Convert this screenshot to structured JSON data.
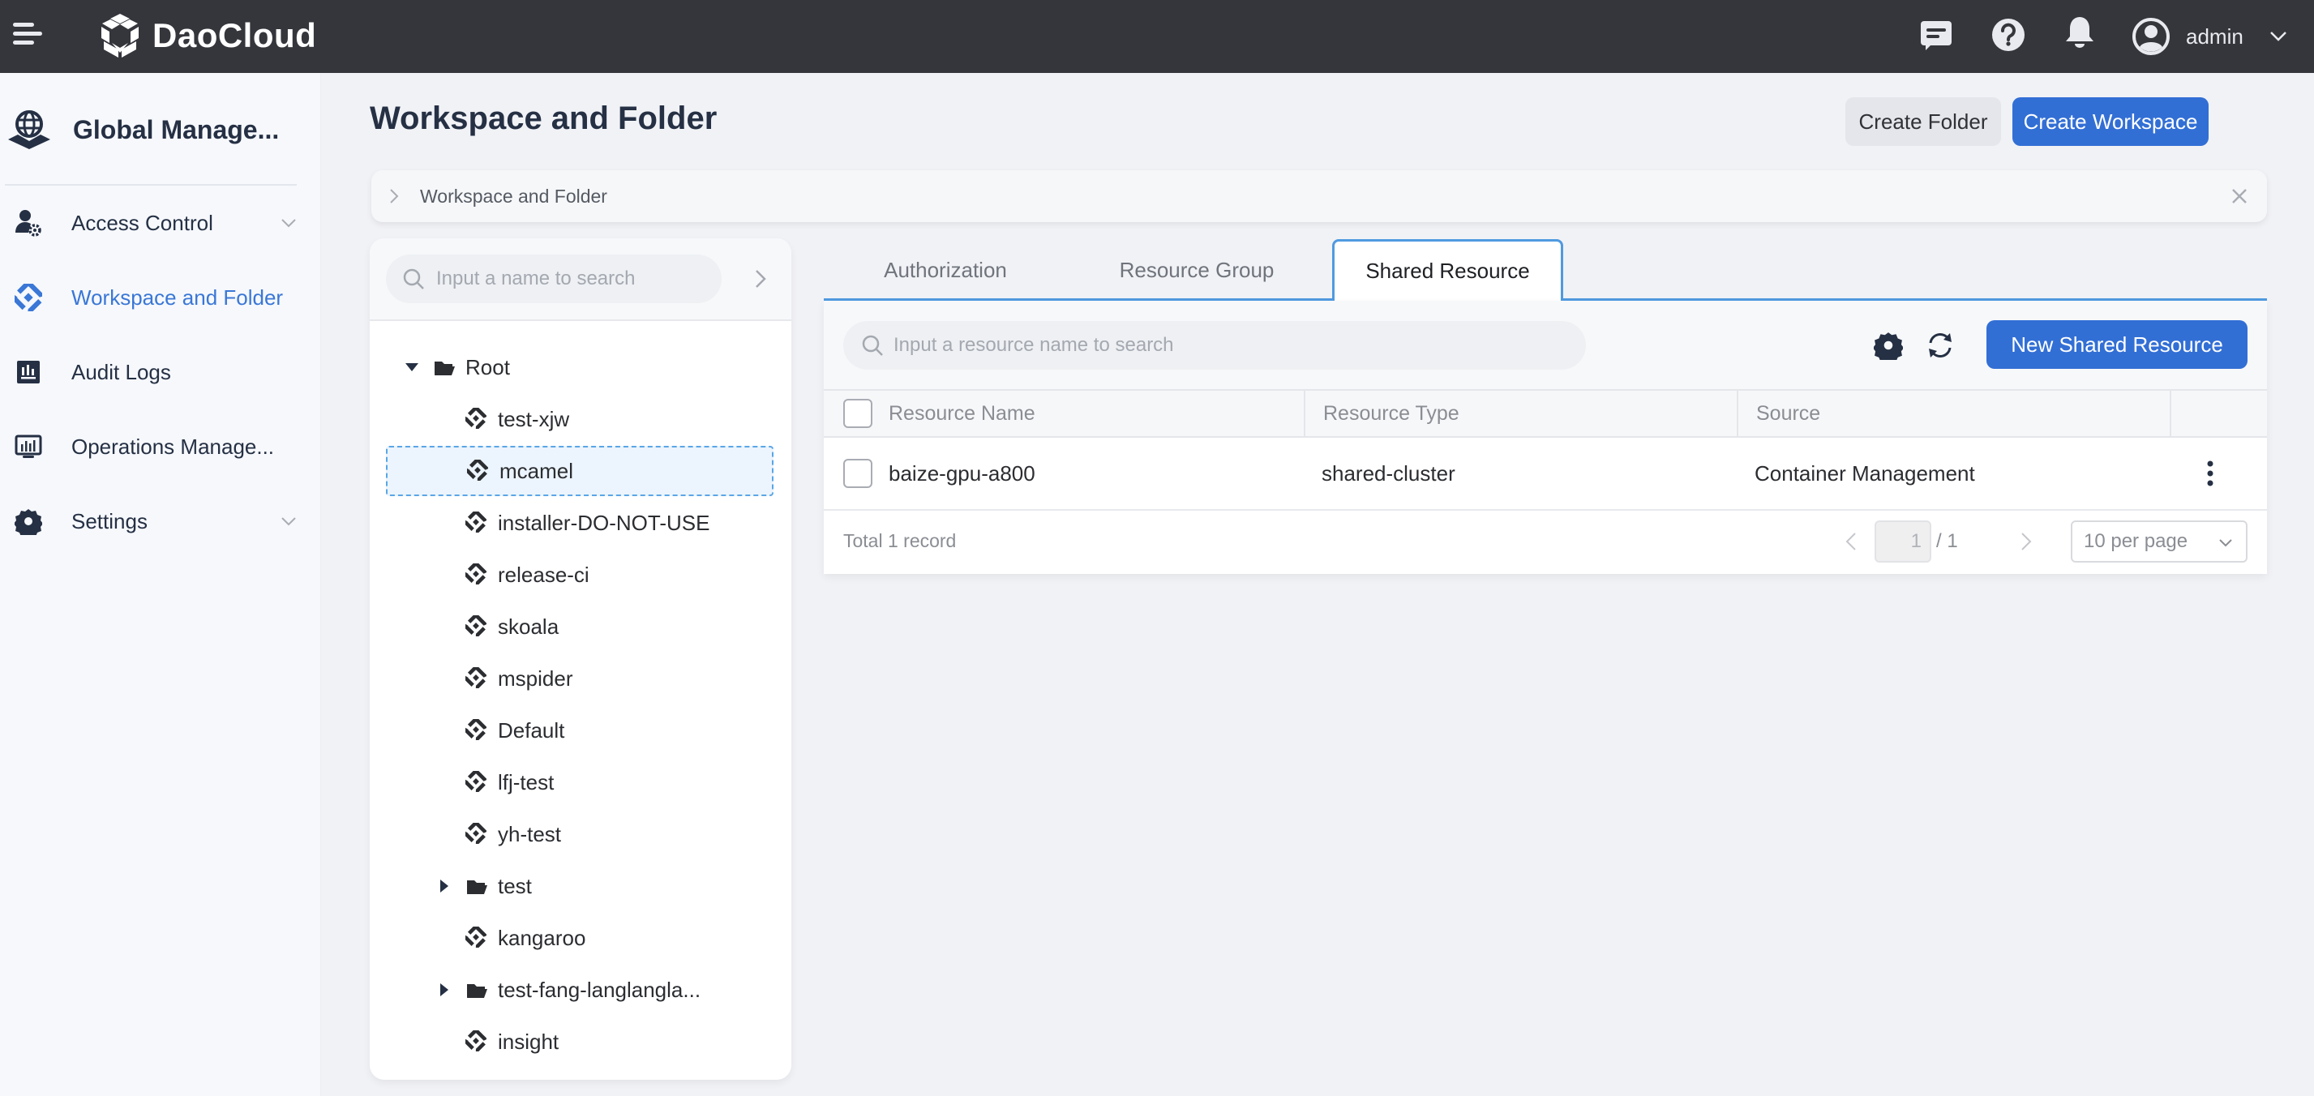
{
  "header": {
    "brand": "DaoCloud",
    "user": "admin"
  },
  "sidebar": {
    "title": "Global Manage...",
    "items": [
      {
        "label": "Access Control",
        "icon": "user-gear-icon",
        "expandable": true,
        "active": false
      },
      {
        "label": "Workspace and Folder",
        "icon": "workspace-icon",
        "expandable": false,
        "active": true
      },
      {
        "label": "Audit Logs",
        "icon": "audit-chart-icon",
        "expandable": false,
        "active": false
      },
      {
        "label": "Operations Manage...",
        "icon": "monitor-chart-icon",
        "expandable": false,
        "active": false
      },
      {
        "label": "Settings",
        "icon": "gear-icon",
        "expandable": true,
        "active": false
      }
    ]
  },
  "page": {
    "title": "Workspace and Folder",
    "create_folder": "Create Folder",
    "create_workspace": "Create Workspace",
    "breadcrumb": "Workspace and Folder"
  },
  "tree": {
    "search_placeholder": "Input a name to search",
    "nodes": [
      {
        "label": "Root",
        "type": "folder",
        "depth": 0,
        "expanded": true,
        "selected": false
      },
      {
        "label": "test-xjw",
        "type": "workspace",
        "depth": 1,
        "selected": false
      },
      {
        "label": "mcamel",
        "type": "workspace",
        "depth": 1,
        "selected": true
      },
      {
        "label": "installer-DO-NOT-USE",
        "type": "workspace",
        "depth": 1,
        "selected": false
      },
      {
        "label": "release-ci",
        "type": "workspace",
        "depth": 1,
        "selected": false
      },
      {
        "label": "skoala",
        "type": "workspace",
        "depth": 1,
        "selected": false
      },
      {
        "label": "mspider",
        "type": "workspace",
        "depth": 1,
        "selected": false
      },
      {
        "label": "Default",
        "type": "workspace",
        "depth": 1,
        "selected": false
      },
      {
        "label": "lfj-test",
        "type": "workspace",
        "depth": 1,
        "selected": false
      },
      {
        "label": "yh-test",
        "type": "workspace",
        "depth": 1,
        "selected": false
      },
      {
        "label": "test",
        "type": "folder",
        "depth": 1,
        "expanded": false,
        "selected": false
      },
      {
        "label": "kangaroo",
        "type": "workspace",
        "depth": 1,
        "selected": false
      },
      {
        "label": "test-fang-langlangla...",
        "type": "folder",
        "depth": 1,
        "expanded": false,
        "selected": false
      },
      {
        "label": "insight",
        "type": "workspace",
        "depth": 1,
        "selected": false
      }
    ]
  },
  "tabs": [
    {
      "label": "Authorization",
      "active": false
    },
    {
      "label": "Resource Group",
      "active": false
    },
    {
      "label": "Shared Resource",
      "active": true
    }
  ],
  "resources": {
    "search_placeholder": "Input a resource name to search",
    "new_button": "New Shared Resource",
    "columns": [
      "Resource Name",
      "Resource Type",
      "Source"
    ],
    "rows": [
      {
        "name": "baize-gpu-a800",
        "type": "shared-cluster",
        "source": "Container Management"
      }
    ],
    "total": "Total 1 record",
    "page_current": "1",
    "page_total": "/ 1",
    "per_page": "10 per page"
  },
  "colors": {
    "header_bg": "#35363c",
    "primary": "#326fd5",
    "active_nav": "#3a77d6",
    "tab_accent": "#4f9ae0"
  }
}
